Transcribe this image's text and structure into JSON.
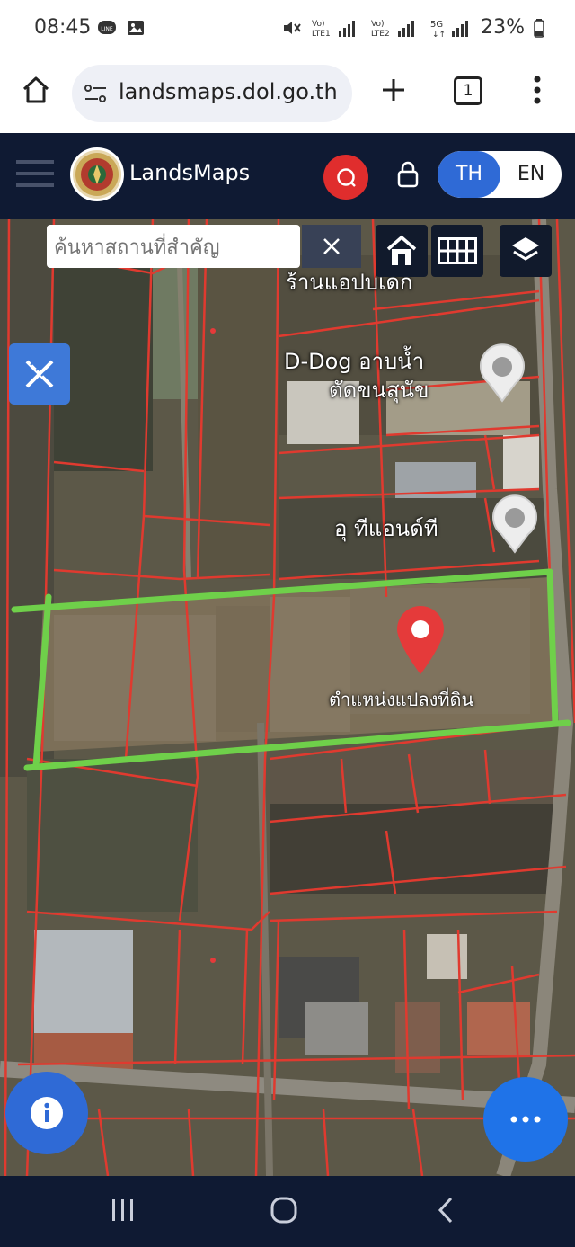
{
  "status_bar": {
    "time": "08:45",
    "left_icons": [
      "line-app-icon",
      "image-icon"
    ],
    "right_icons": [
      "mute-icon",
      "volte-lte1-signal-icon",
      "volte-lte2-signal-icon",
      "5g-signal-icon"
    ],
    "volte1_label": "Vo) LTE1",
    "volte2_label": "Vo) LTE2",
    "net_label": "5G",
    "battery": "23%"
  },
  "browser": {
    "url": "landsmaps.dol.go.th",
    "tab_count": "1",
    "buttons": [
      "home-icon",
      "site-settings-icon",
      "new-tab-icon",
      "tab-switcher-icon",
      "more-vertical-icon"
    ]
  },
  "app_header": {
    "brand": "LandsMaps",
    "lang_th": "TH",
    "lang_en": "EN",
    "active_lang": "TH",
    "accent_color": "#2f6ad6",
    "search_color": "#e02d2d"
  },
  "map": {
    "search_placeholder": "ค้นหาสถานที่สำคัญ",
    "poi_labels": [
      {
        "text": "ร้านแอปบเด็ก"
      },
      {
        "text": "D-Dog อาบน้ำ"
      },
      {
        "text": "ตัดขนสุนัข"
      },
      {
        "text": "อุ ทีแอนด์ที"
      },
      {
        "text": "ตำแหน่งแปลงที่ดิน"
      }
    ],
    "marker_color": "#e53a3a",
    "parcel_line_color": "#e03a2f",
    "highlight_color": "#6fd04a"
  },
  "nav_bar": {
    "buttons": [
      "recent-apps-icon",
      "home-circle-icon",
      "back-icon"
    ]
  }
}
